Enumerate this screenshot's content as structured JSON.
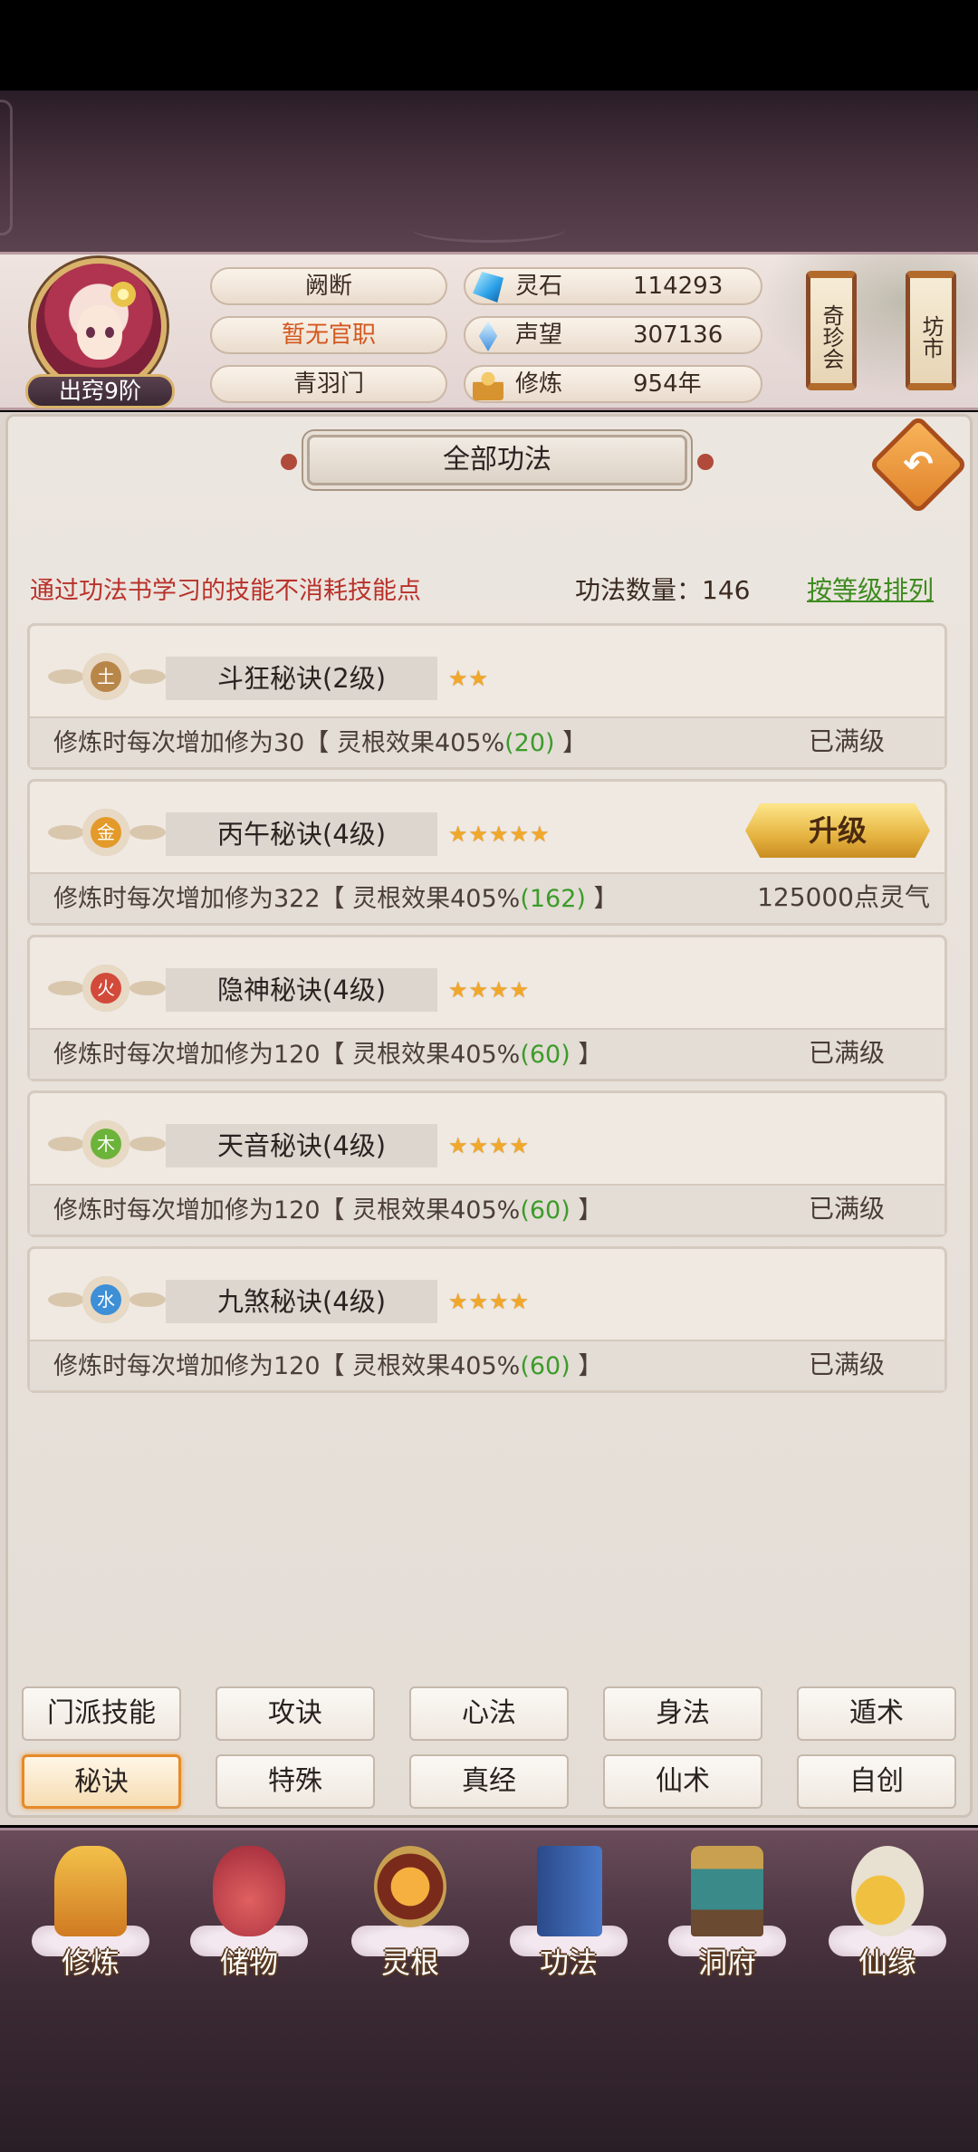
{
  "header": {
    "rank_badge": "出窍9阶",
    "name": "阙断",
    "official_post": "暂无官职",
    "sect": "青羽门",
    "stats": [
      {
        "icon": "spirit-stone-icon",
        "label": "灵石",
        "value": "114293"
      },
      {
        "icon": "reputation-icon",
        "label": "声望",
        "value": "307136"
      },
      {
        "icon": "cultivation-icon",
        "label": "修炼",
        "value": "954年"
      }
    ],
    "scroll_buttons": [
      "奇珍会",
      "坊市"
    ]
  },
  "panel": {
    "title": "全部功法",
    "hint": "通过功法书学习的技能不消耗技能点",
    "count_label": "功法数量：146",
    "sort_link": "按等级排列"
  },
  "skills": [
    {
      "element": "土",
      "element_color": "#b9864a",
      "name": "斗狂秘诀(2级)",
      "stars": "★★",
      "desc": "修炼时每次增加修为30【 灵根效果405%",
      "bonus": "(20)",
      "desc_end": " 】",
      "status": "已满级"
    },
    {
      "element": "金",
      "element_color": "#e39a2a",
      "name": "丙午秘诀(4级)",
      "stars": "★★★★★",
      "desc": "修炼时每次增加修为322【 灵根效果405%",
      "bonus": "(162)",
      "desc_end": " 】",
      "status": "125000点灵气",
      "upgrade_label": "升级"
    },
    {
      "element": "火",
      "element_color": "#d24a3a",
      "name": "隐神秘诀(4级)",
      "stars": "★★★★",
      "desc": "修炼时每次增加修为120【 灵根效果405%",
      "bonus": "(60)",
      "desc_end": " 】",
      "status": "已满级"
    },
    {
      "element": "木",
      "element_color": "#6cb33a",
      "name": "天音秘诀(4级)",
      "stars": "★★★★",
      "desc": "修炼时每次增加修为120【 灵根效果405%",
      "bonus": "(60)",
      "desc_end": " 】",
      "status": "已满级"
    },
    {
      "element": "水",
      "element_color": "#3d8fd6",
      "name": "九煞秘诀(4级)",
      "stars": "★★★★",
      "desc": "修炼时每次增加修为120【 灵根效果405%",
      "bonus": "(60)",
      "desc_end": " 】",
      "status": "已满级"
    }
  ],
  "tabs": [
    "门派技能",
    "攻诀",
    "心法",
    "身法",
    "遁术",
    "秘诀",
    "特殊",
    "真经",
    "仙术",
    "自创"
  ],
  "active_tab": "秘诀",
  "nav": [
    {
      "label": "修炼",
      "icon": "cultivate-monk-icon"
    },
    {
      "label": "储物",
      "icon": "storage-bag-icon"
    },
    {
      "label": "灵根",
      "icon": "spirit-root-icon"
    },
    {
      "label": "功法",
      "icon": "technique-book-icon"
    },
    {
      "label": "洞府",
      "icon": "cave-dwelling-icon"
    },
    {
      "label": "仙缘",
      "icon": "immortal-fate-icon"
    }
  ],
  "colors": {
    "accent": "#e58a2a",
    "hint_red": "#b8322b",
    "link_green": "#3d8b1f",
    "bonus_green": "#3d9b2a",
    "star": "#f1a82a"
  }
}
